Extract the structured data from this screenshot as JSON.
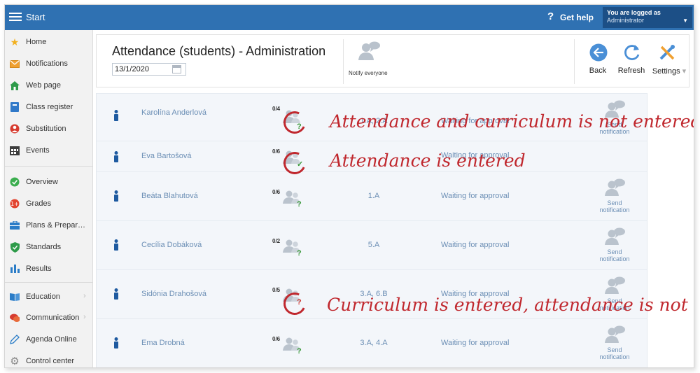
{
  "topbar": {
    "start_label": "Start",
    "help_mark": "?",
    "help_label": "Get help",
    "user_line1": "You are logged as",
    "user_line2": "Administrator"
  },
  "sidebar": {
    "items": [
      {
        "label": "Home",
        "icon": "star-icon"
      },
      {
        "label": "Notifications",
        "icon": "envelope-icon"
      },
      {
        "label": "Web page",
        "icon": "house-icon"
      },
      {
        "label": "Class register",
        "icon": "book-icon"
      },
      {
        "label": "Substitution",
        "icon": "person-swap-icon"
      },
      {
        "label": "Events",
        "icon": "calendar-icon"
      },
      {
        "label": "Overview",
        "icon": "check-circle-icon"
      },
      {
        "label": "Grades",
        "icon": "grades-icon"
      },
      {
        "label": "Plans & Prepar…",
        "icon": "briefcase-icon"
      },
      {
        "label": "Standards",
        "icon": "shield-check-icon"
      },
      {
        "label": "Results",
        "icon": "bar-chart-icon"
      },
      {
        "label": "Education",
        "icon": "open-book-icon"
      },
      {
        "label": "Communication",
        "icon": "chat-icon"
      },
      {
        "label": "Agenda Online",
        "icon": "pencil-icon"
      },
      {
        "label": "Control center",
        "icon": "gear-icon"
      }
    ]
  },
  "header": {
    "title": "Attendance (students) - Administration",
    "date_value": "13/1/2020",
    "notify_label": "Notify everyone",
    "back_label": "Back",
    "refresh_label": "Refresh",
    "settings_label": "Settings",
    "settings_caret": "▾"
  },
  "rows": [
    {
      "name": "Karolína Anderlová",
      "count": "0/4",
      "mark": "?",
      "cls": "1.A, 2.A",
      "status": "Waiting for approval",
      "send1": "Send",
      "send2": "notification"
    },
    {
      "name": "Eva Bartošová",
      "count": "0/6",
      "mark": "✓",
      "cls": "",
      "status": "Waiting for approval",
      "send1": "",
      "send2": ""
    },
    {
      "name": "Beáta Blahutová",
      "count": "0/6",
      "mark": "?",
      "cls": "1.A",
      "status": "Waiting for approval",
      "send1": "Send",
      "send2": "notification"
    },
    {
      "name": "Cecília Dobáková",
      "count": "0/2",
      "mark": "?",
      "cls": "5.A",
      "status": "Waiting for approval",
      "send1": "Send",
      "send2": "notification"
    },
    {
      "name": "Sidónia Drahošová",
      "count": "0/5",
      "mark": "?",
      "cls": "3.A, 6.B",
      "status": "Waiting for approval",
      "send1": "Send",
      "send2": "notification"
    },
    {
      "name": "Ema Drobná",
      "count": "0/6",
      "mark": "?",
      "cls": "3.A, 4.A",
      "status": "Waiting for approval",
      "send1": "Send",
      "send2": "notification"
    }
  ],
  "annotations": {
    "a1": "Attendance and curriculum is not entered",
    "a2": "Attendance is entered",
    "a3": "Curriculum is entered, attendance is not"
  },
  "colors": {
    "topbar": "#2f71b2",
    "accent_red": "#c0282e",
    "link_blue": "#6c8fb5",
    "mark_green": "#3a9a3a",
    "mark_red": "#d0342c"
  }
}
